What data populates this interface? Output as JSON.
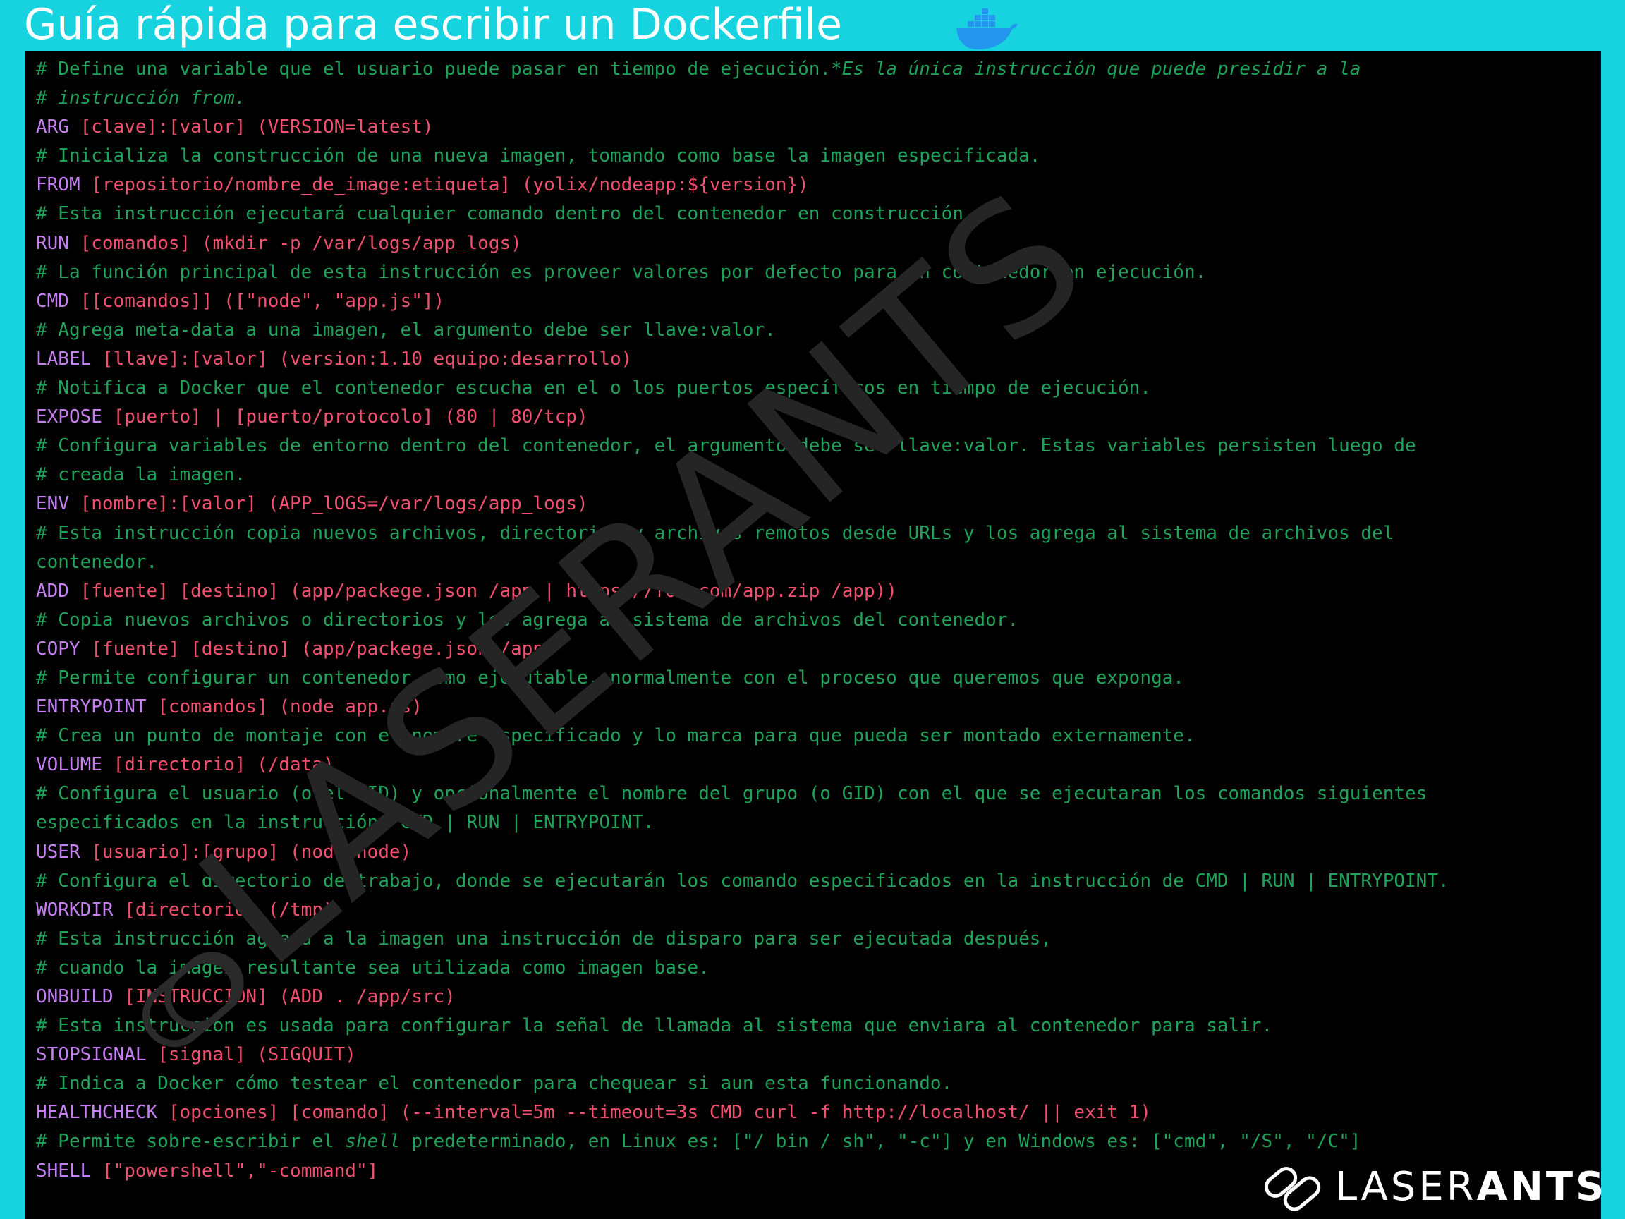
{
  "header": {
    "title": "Guía rápida para escribir un Dockerfile",
    "icon": "docker-whale-icon"
  },
  "colors": {
    "background": "#17d3e0",
    "terminal": "#000000",
    "comment": "#1fa25a",
    "keyword": "#c67ff0",
    "argument": "#f0506e"
  },
  "code": [
    {
      "type": "comment",
      "text": "# Define una variable que el usuario puede pasar en tiempo de ejecución.",
      "em": "*Es la única instrucción que puede presidir a la"
    },
    {
      "type": "comment",
      "text": "# ",
      "em": "instrucción from."
    },
    {
      "type": "instr",
      "kw": "ARG",
      "arg": " [clave]:[valor] (VERSION=latest)"
    },
    {
      "type": "comment",
      "text": "# Inicializa la construcción de una nueva imagen, tomando como base la imagen especificada."
    },
    {
      "type": "instr",
      "kw": "FROM",
      "arg": " [repositorio/nombre_de_image:etiqueta] (yolix/nodeapp:${version})"
    },
    {
      "type": "comment",
      "text": "# Esta instrucción ejecutará cualquier comando dentro del contenedor en construcción."
    },
    {
      "type": "instr",
      "kw": "RUN",
      "arg": " [comandos] (mkdir -p /var/logs/app_logs)"
    },
    {
      "type": "comment",
      "text": "# La función principal de esta instrucción es proveer valores por defecto para un contenedor en ejecución."
    },
    {
      "type": "instr",
      "kw": "CMD",
      "arg": " [[comandos]] ([\"node\", \"app.js\"])"
    },
    {
      "type": "comment",
      "text": "# Agrega meta-data a una imagen, el argumento debe ser llave:valor."
    },
    {
      "type": "instr",
      "kw": "LABEL",
      "arg": " [llave]:[valor] (version:1.10 equipo:desarrollo)"
    },
    {
      "type": "comment",
      "text": "# Notifica a Docker que el contenedor escucha en el o los puertos específicos en tiempo de ejecución."
    },
    {
      "type": "instr",
      "kw": "EXPOSE",
      "arg": " [puerto] | [puerto/protocolo] (80 | 80/tcp)"
    },
    {
      "type": "comment",
      "text": "# Configura variables de entorno dentro del contenedor, el argumento debe ser llave:valor. Estas variables persisten luego de"
    },
    {
      "type": "comment",
      "text": "# creada la imagen."
    },
    {
      "type": "instr",
      "kw": "ENV",
      "arg": " [nombre]:[valor] (APP_lOGS=/var/logs/app_logs)"
    },
    {
      "type": "comment",
      "text": "# Esta instrucción copia nuevos archivos, directorios y archivos remotos desde URLs y los agrega al sistema de archivos del"
    },
    {
      "type": "comment",
      "text": "contenedor."
    },
    {
      "type": "instr",
      "kw": "ADD",
      "arg": " [fuente] [destino] (app/packege.json /app | https://foo.com/app.zip /app))"
    },
    {
      "type": "comment",
      "text": "# Copia nuevos archivos o directorios y los agrega al sistema de archivos del contenedor."
    },
    {
      "type": "instr",
      "kw": "COPY",
      "arg": " [fuente] [destino] (app/packege.json /app)"
    },
    {
      "type": "comment",
      "text": "# Permite configurar un contenedor como ejecutable, normalmente con el proceso que queremos que exponga."
    },
    {
      "type": "instr",
      "kw": "ENTRYPOINT",
      "arg": " [comandos] (node app.js)"
    },
    {
      "type": "comment",
      "text": "# Crea un punto de montaje con el nombre especificado y lo marca para que pueda ser montado externamente."
    },
    {
      "type": "instr",
      "kw": "VOLUME",
      "arg": " [directorio] (/data)"
    },
    {
      "type": "comment",
      "text": "# Configura el usuario (o el UID) y opcionalmente el nombre del grupo (o GID) con el que se ejecutaran los comandos siguientes"
    },
    {
      "type": "comment",
      "text": "especificados en la instrucción: CMD | RUN | ENTRYPOINT."
    },
    {
      "type": "instr",
      "kw": "USER",
      "arg": " [usuario]:[grupo] (node:node)"
    },
    {
      "type": "comment",
      "text": "# Configura el directorio de trabajo, donde se ejecutarán los comando especificados en la instrucción de CMD | RUN | ENTRYPOINT."
    },
    {
      "type": "instr",
      "kw": "WORKDIR",
      "arg": " [directorio] (/tmp)"
    },
    {
      "type": "comment",
      "text": "# Esta instrucción agrega a la imagen una instrucción de disparo para ser ejecutada después,"
    },
    {
      "type": "comment",
      "text": "# cuando la imagen resultante sea utilizada como imagen base."
    },
    {
      "type": "instr",
      "kw": "ONBUILD",
      "arg": " [INSTRUCCIÓN] (ADD . /app/src)"
    },
    {
      "type": "comment",
      "text": "# Esta instrucción es usada para configurar la señal de llamada al sistema que enviara al contenedor para salir."
    },
    {
      "type": "instr",
      "kw": "STOPSIGNAL",
      "arg": " [signal] (SIGQUIT)"
    },
    {
      "type": "comment",
      "text": "# Indica a Docker cómo testear el contenedor para chequear si aun esta funcionando."
    },
    {
      "type": "instr",
      "kw": "HEALTHCHECK",
      "arg": " [opciones] [comando] (--interval=5m --timeout=3s CMD curl -f http://localhost/ || exit 1)"
    },
    {
      "type": "comment",
      "text": "# Permite sobre-escribir el ",
      "em": "shell",
      "tail": " predeterminado, en Linux es: [\"/ bin / sh\", \"-c\"] y en Windows es: [\"cmd\", \"/S\", \"/C\"]"
    },
    {
      "type": "instr",
      "kw": "SHELL",
      "arg": " [\"powershell\",\"-command\"]"
    }
  ],
  "watermark": {
    "text": "LASERANTS",
    "icon": "laserants-logo-icon"
  },
  "brand": {
    "light": "LASER",
    "bold": "ANTS",
    "icon": "laserants-logo-icon"
  }
}
